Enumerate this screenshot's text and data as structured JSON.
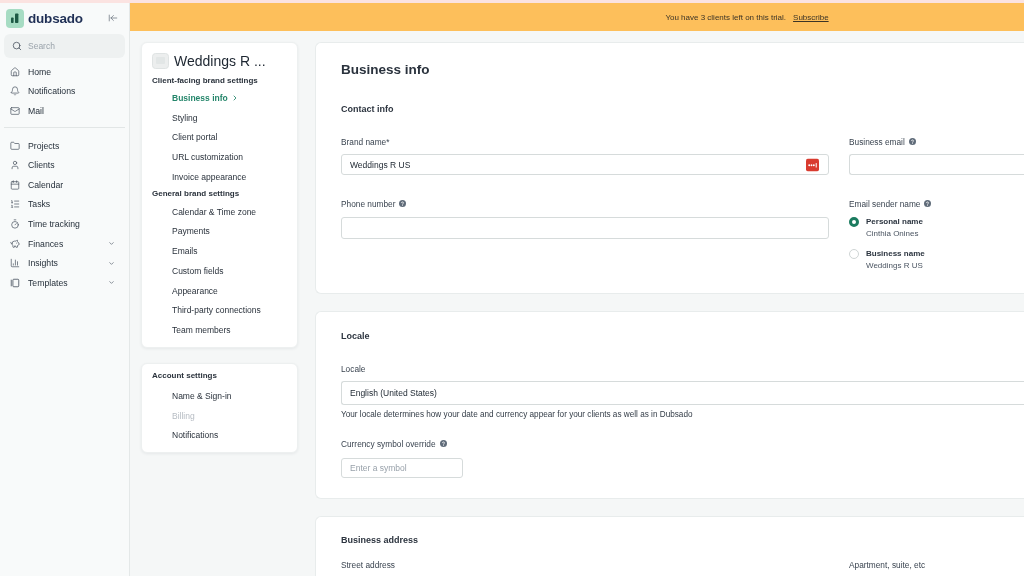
{
  "sidebar": {
    "logo": "dubsado",
    "search": {
      "placeholder": "Search"
    },
    "sections": [
      {
        "items": [
          {
            "label": "Home",
            "selected": false,
            "expandable": false
          },
          {
            "label": "Notifications",
            "selected": false,
            "expandable": false
          },
          {
            "label": "Mail",
            "selected": false,
            "expandable": false
          }
        ]
      },
      {
        "items": [
          {
            "label": "Projects",
            "selected": false,
            "expandable": false
          },
          {
            "label": "Clients",
            "selected": false,
            "expandable": false
          },
          {
            "label": "Calendar",
            "selected": false,
            "expandable": false
          },
          {
            "label": "Tasks",
            "selected": false,
            "expandable": false
          },
          {
            "label": "Time tracking",
            "selected": false,
            "expandable": false
          },
          {
            "label": "Finances",
            "selected": false,
            "expandable": true
          },
          {
            "label": "Insights",
            "selected": false,
            "expandable": true
          },
          {
            "label": "Templates",
            "selected": false,
            "expandable": true
          }
        ]
      }
    ]
  },
  "banner": {
    "message": "You have 3 clients left on this trial.",
    "link": "Subscribe"
  },
  "settings_menu": {
    "brand": "Weddings R ...",
    "groups": [
      {
        "heading": "Client-facing brand settings",
        "items": [
          {
            "label": "Business info",
            "selected": true
          },
          {
            "label": "Styling",
            "selected": false
          },
          {
            "label": "Client portal",
            "selected": false
          },
          {
            "label": "URL customization",
            "selected": false
          },
          {
            "label": "Invoice appearance",
            "selected": false
          }
        ]
      },
      {
        "heading": "General brand settings",
        "items": [
          {
            "label": "Calendar & Time zone",
            "selected": false
          },
          {
            "label": "Payments",
            "selected": false
          },
          {
            "label": "Emails",
            "selected": false
          },
          {
            "label": "Custom fields",
            "selected": false
          },
          {
            "label": "Appearance",
            "selected": false
          },
          {
            "label": "Third-party connections",
            "selected": false
          },
          {
            "label": "Team members",
            "selected": false
          }
        ]
      }
    ]
  },
  "account_menu": {
    "heading": "Account settings",
    "items": [
      {
        "label": "Name & Sign-in",
        "selected": false,
        "disabled": false
      },
      {
        "label": "Billing",
        "selected": false,
        "disabled": true
      },
      {
        "label": "Notifications",
        "selected": false,
        "disabled": false
      }
    ]
  },
  "business_info": {
    "title": "Business info",
    "heading": "Contact info",
    "brand_name": {
      "label": "Brand name*",
      "value": "Weddings R US"
    },
    "business_email": {
      "label": "Business email",
      "help": true
    },
    "phone_number": {
      "label": "Phone number",
      "help": true
    },
    "email_sender": {
      "label": "Email sender name",
      "help": true,
      "options": [
        {
          "label": "Personal name",
          "detail": "Cinthia Onines",
          "selected": true
        },
        {
          "label": "Business name",
          "detail": "Weddings R US",
          "selected": false
        }
      ]
    }
  },
  "locale": {
    "title": "Locale",
    "locale_field": {
      "label": "Locale",
      "value": "English (United States)",
      "hint": "Your locale determines how your date and currency appear for your clients as well as in Dubsado"
    },
    "currency_field": {
      "label": "Currency symbol override",
      "help": true,
      "placeholder": "Enter a symbol"
    }
  },
  "business_address": {
    "title": "Business address",
    "fields": [
      {
        "label": "Street address"
      },
      {
        "label": "Apartment, suite, etc"
      }
    ]
  }
}
